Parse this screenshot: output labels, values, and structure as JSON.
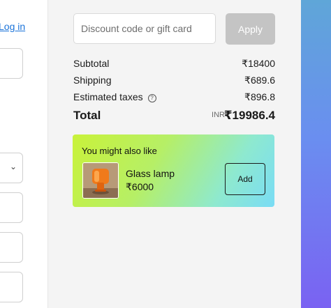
{
  "account": {
    "login_link": "Log in"
  },
  "discount": {
    "placeholder": "Discount code or gift card",
    "apply_label": "Apply"
  },
  "summary": {
    "subtotal_label": "Subtotal",
    "subtotal_value": "₹18400",
    "shipping_label": "Shipping",
    "shipping_value": "₹689.6",
    "taxes_label": "Estimated taxes",
    "taxes_value": "₹896.8",
    "total_label": "Total",
    "total_currency": "INR",
    "total_value": "₹19986.4"
  },
  "upsell": {
    "title": "You might also like",
    "product_name": "Glass lamp",
    "product_price": "₹6000",
    "add_label": "Add"
  },
  "colors": {
    "summary_bg": "#f4f4f4",
    "apply_disabled": "#c4c4c4",
    "link": "#1a73d9"
  }
}
